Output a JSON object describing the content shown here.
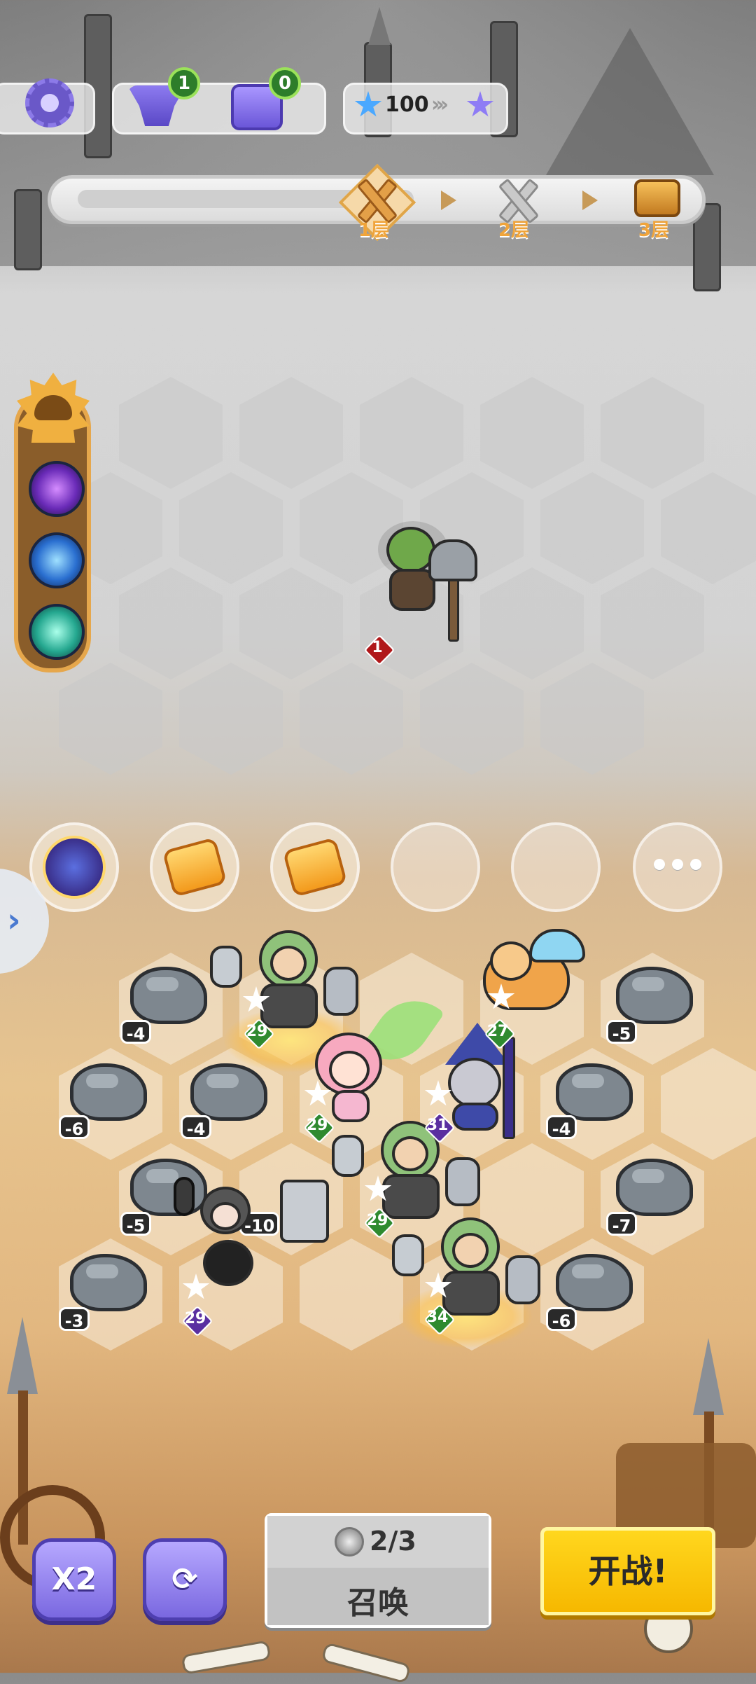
{
  "resources": {
    "anvil_count": "1",
    "chest_count": "0",
    "stars": "100"
  },
  "stages": [
    {
      "label": "1层",
      "state": "current"
    },
    {
      "label": "2层",
      "state": "locked"
    },
    {
      "label": "3层",
      "state": "reward"
    }
  ],
  "enemy": {
    "level": "1"
  },
  "rocks": {
    "r1": "-4",
    "r2": "-5",
    "r3": "-6",
    "r4": "-4",
    "r5": "-4",
    "r6": "-5",
    "r7": "-10",
    "r8": "-7",
    "r9": "-3",
    "r10": "-6"
  },
  "units": {
    "warrior1": "29",
    "corgi": "27",
    "elf": "29",
    "wizard": "31",
    "warrior2": "29",
    "crow_girl": "29",
    "warrior3": "34"
  },
  "controls": {
    "speed_label": "X2",
    "summon_count": "2/3",
    "summon_label": "召唤",
    "fight_label": "开战!"
  },
  "colors": {
    "accent_purple": "#7a68e0",
    "fight_yellow": "#f6b800",
    "stage_gold": "#e3a048"
  }
}
